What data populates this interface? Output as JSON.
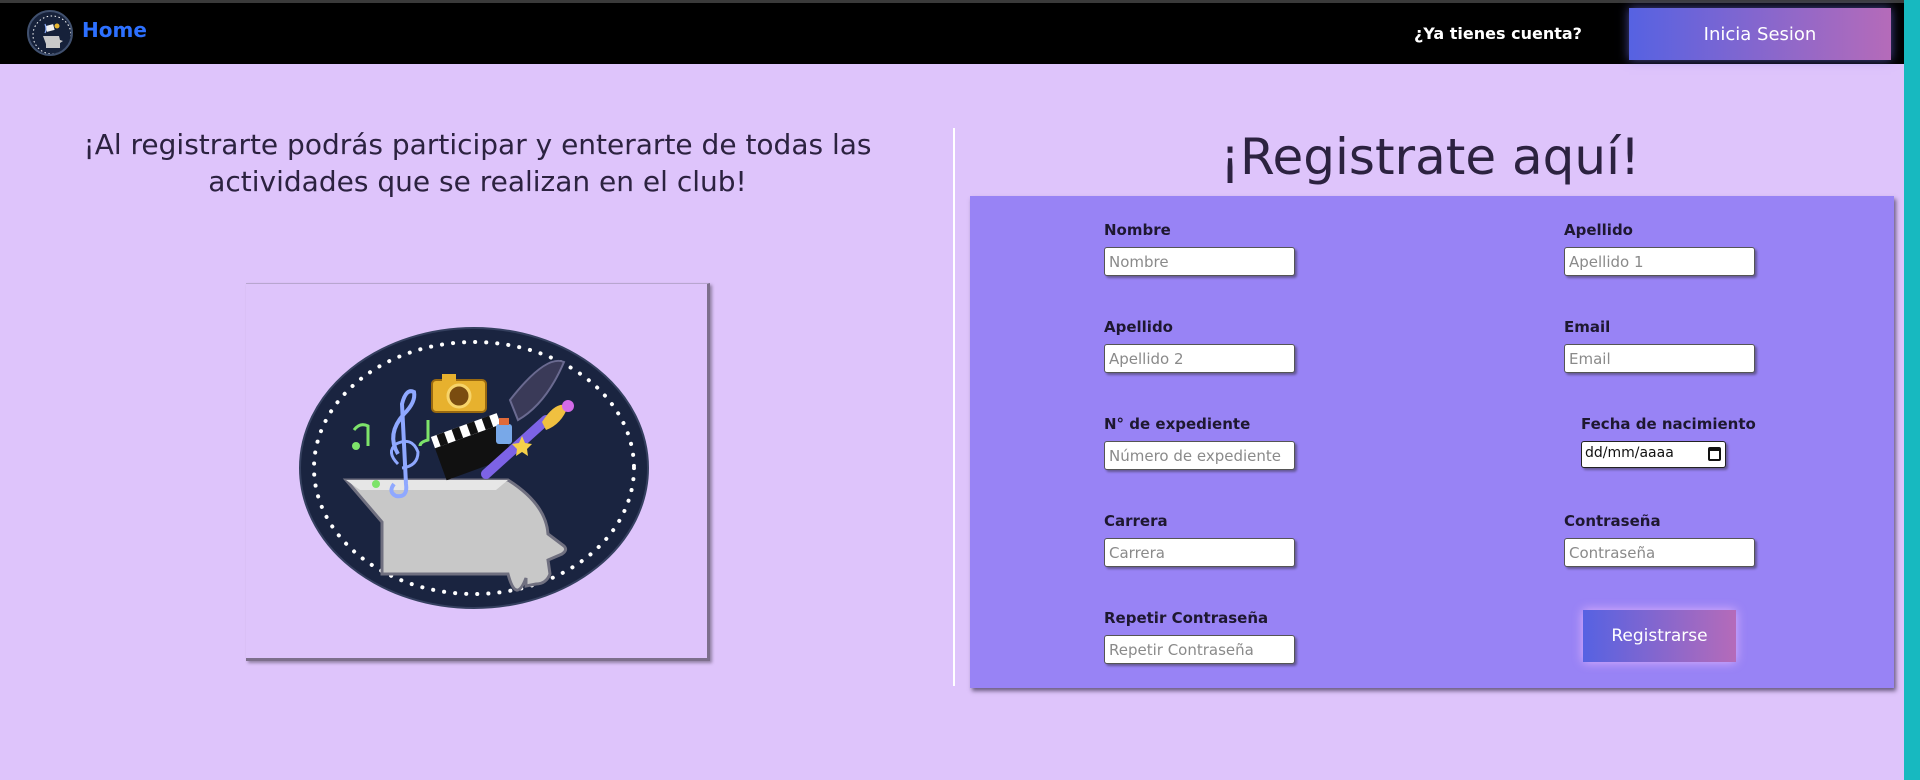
{
  "nav": {
    "home_label": "Home",
    "question": "¿Ya tienes cuenta?",
    "login_label": "Inicia Sesion"
  },
  "intro": {
    "text": "¡Al registrarte podrás participar y enterarte de todas las actividades que se realizan en el club!"
  },
  "form": {
    "title": "¡Registrate aquí!",
    "fields": {
      "nombre": {
        "label": "Nombre",
        "placeholder": "Nombre"
      },
      "apellido1": {
        "label": "Apellido",
        "placeholder": "Apellido 1"
      },
      "apellido2": {
        "label": "Apellido",
        "placeholder": "Apellido 2"
      },
      "email": {
        "label": "Email",
        "placeholder": "Email"
      },
      "expediente": {
        "label": "N° de expediente",
        "placeholder": "Número de expediente"
      },
      "fecha": {
        "label": "Fecha de nacimiento",
        "placeholder": "dd/mm/aaaa"
      },
      "carrera": {
        "label": "Carrera",
        "placeholder": "Carrera"
      },
      "contrasena": {
        "label": "Contraseña",
        "placeholder": "Contraseña"
      },
      "repetir": {
        "label": "Repetir Contraseña",
        "placeholder": "Repetir Contraseña"
      }
    },
    "submit_label": "Registrarse"
  },
  "colors": {
    "background": "#dec4fb",
    "navbar": "#000000",
    "form_panel": "#9883f5",
    "home_link": "#2d70ff",
    "button_gradient_start": "#5662e2",
    "button_gradient_end": "#b56bb9"
  },
  "icons": {
    "logo": "club-logo-icon",
    "calendar": "calendar-icon"
  }
}
